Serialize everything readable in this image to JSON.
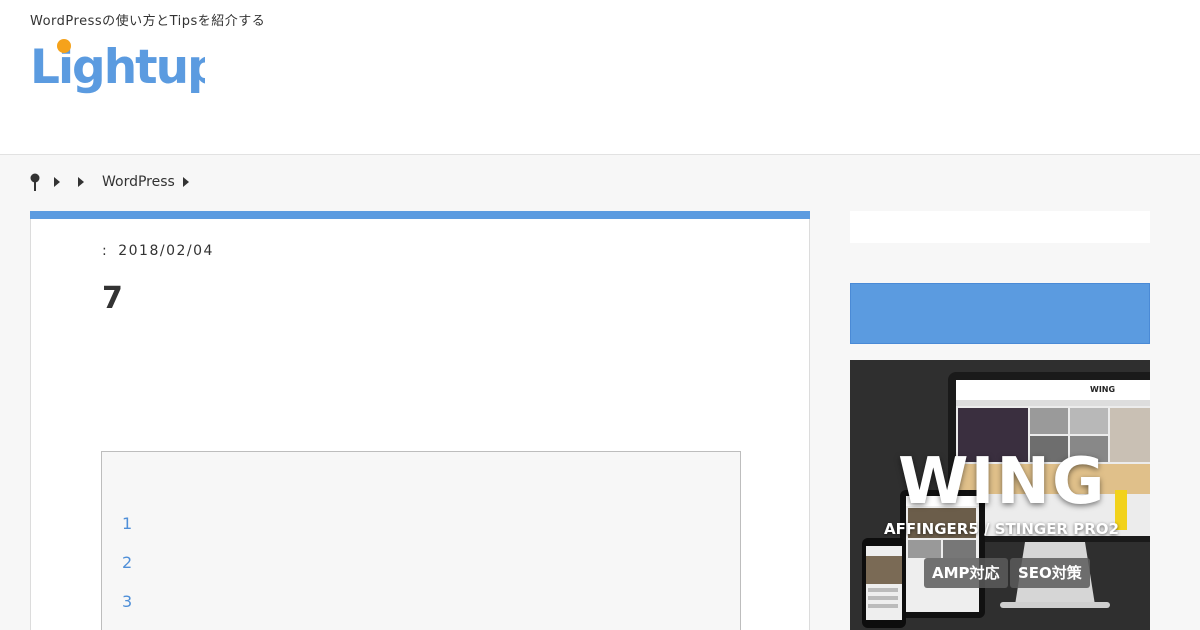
{
  "header": {
    "tagline": "WordPressの使い方とTipsを紹介する",
    "logo_text": "Lightup"
  },
  "breadcrumb": {
    "items": [
      "WordPress"
    ]
  },
  "post": {
    "date_label": ":",
    "date": "2018/02/04",
    "title": "7"
  },
  "toc": {
    "items": [
      "1",
      "2",
      "3"
    ]
  },
  "sidebar": {
    "ad": {
      "title": "WING",
      "subtitle": "AFFINGER5 / STINGER PRO2",
      "badges": [
        "AMP対応",
        "SEO対策"
      ],
      "site_name": "WING"
    }
  },
  "colors": {
    "accent": "#5b9be0",
    "logo_dot": "#f5a21b",
    "link": "#4f8fd8"
  }
}
